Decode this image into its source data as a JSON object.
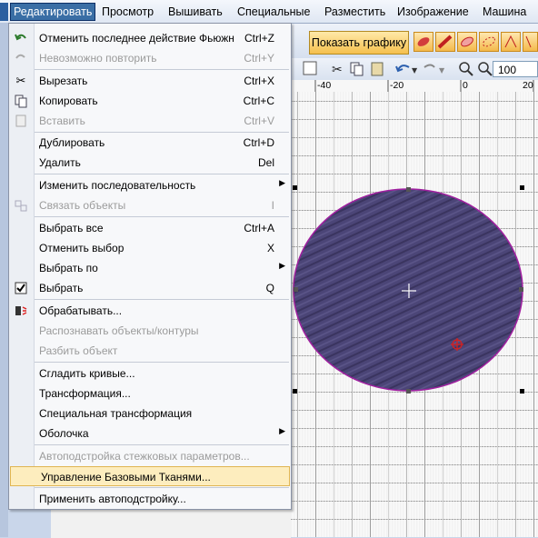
{
  "menubar": {
    "items": [
      "Редактировать",
      "Просмотр",
      "Вышивать",
      "Специальные",
      "Разместить",
      "Изображение",
      "Машина"
    ]
  },
  "toolbar": {
    "graph_button": "Показать графику",
    "zoom_value": "100"
  },
  "ruler": {
    "labels": [
      "-40",
      "-20",
      "0",
      "20"
    ]
  },
  "menu": {
    "items": [
      {
        "label": "Отменить последнее действие Фьюжн",
        "shortcut": "Ctrl+Z",
        "icon": "undo-icon"
      },
      {
        "label": "Невозможно повторить",
        "shortcut": "Ctrl+Y",
        "icon": "redo-icon",
        "disabled": true
      },
      {
        "label": "Вырезать",
        "shortcut": "Ctrl+X",
        "icon": "scissors-icon"
      },
      {
        "label": "Копировать",
        "shortcut": "Ctrl+C",
        "icon": "copy-icon"
      },
      {
        "label": "Вставить",
        "shortcut": "Ctrl+V",
        "icon": "paste-icon",
        "disabled": true
      },
      {
        "label": "Дублировать",
        "shortcut": "Ctrl+D"
      },
      {
        "label": "Удалить",
        "shortcut": "Del"
      },
      {
        "label": "Изменить последовательность",
        "submenu": true
      },
      {
        "label": "Связать объекты",
        "shortcut": "I",
        "icon": "link-objects-icon",
        "disabled": true
      },
      {
        "label": "Выбрать все",
        "shortcut": "Ctrl+A"
      },
      {
        "label": "Отменить выбор",
        "shortcut": "X"
      },
      {
        "label": "Выбрать по",
        "submenu": true
      },
      {
        "label": "Выбрать",
        "shortcut": "Q",
        "icon": "checkbox-icon"
      },
      {
        "label": "Обрабатывать...",
        "icon": "process-icon"
      },
      {
        "label": "Распознавать объекты/контуры",
        "disabled": true
      },
      {
        "label": "Разбить объект",
        "disabled": true
      },
      {
        "label": "Сгладить кривые..."
      },
      {
        "label": "Трансформация..."
      },
      {
        "label": "Специальная трансформация"
      },
      {
        "label": "Оболочка",
        "submenu": true
      },
      {
        "label": "Автоподстройка стежковых параметров...",
        "disabled": true
      },
      {
        "label": "Управление Базовыми Тканями...",
        "highlighted": true
      },
      {
        "label": "Применить автоподстройку..."
      }
    ]
  },
  "colors": {
    "ellipse_fill": "#4b4577",
    "ellipse_outline": "#a020a0",
    "menu_highlight": "#fdedbe"
  }
}
